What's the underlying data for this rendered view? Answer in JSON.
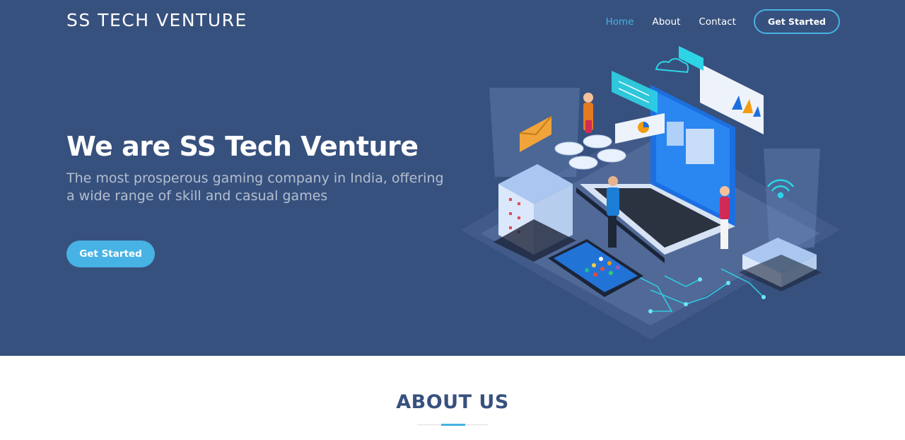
{
  "header": {
    "logo": "SS TECH VENTURE",
    "nav": [
      {
        "label": "Home",
        "active": true
      },
      {
        "label": "About",
        "active": false
      },
      {
        "label": "Contact",
        "active": false
      }
    ],
    "cta_label": "Get Started"
  },
  "hero": {
    "title": "We are SS Tech Venture",
    "subtitle": "The most prosperous gaming company in India, offering a wide range of skill and casual games",
    "button_label": "Get Started",
    "illustration": "isometric-tech-illustration"
  },
  "about": {
    "title": "ABOUT US"
  },
  "colors": {
    "hero_bg": "#37517e",
    "accent": "#47b2e4",
    "text_light": "#ffffff",
    "heading_dark": "#37517e"
  }
}
